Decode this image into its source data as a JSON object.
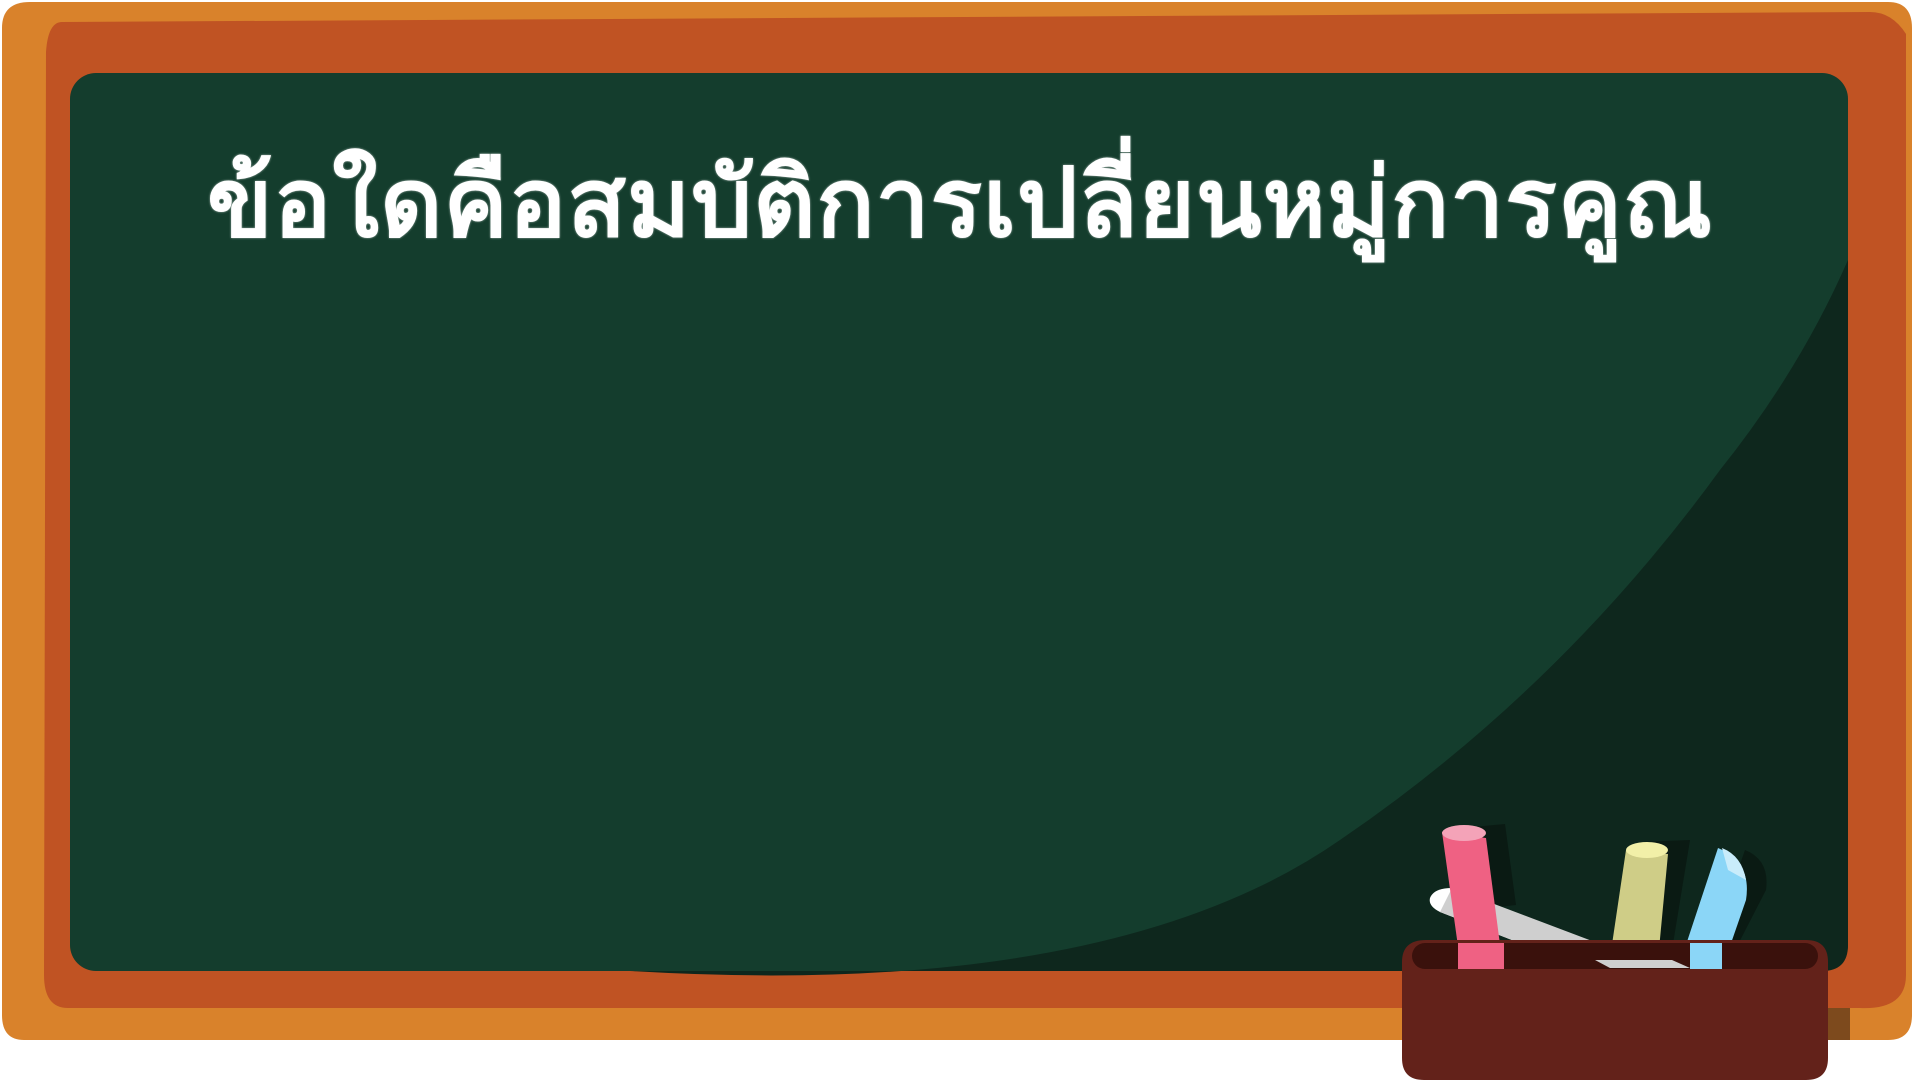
{
  "slide": {
    "title": "ข้อใดคือสมบัติการเปลี่ยนหมู่การคูณ"
  },
  "colors": {
    "outer_frame": "#d9822b",
    "inner_frame": "#c05323",
    "board": "#143d2d",
    "board_shadow": "#0e271d",
    "text": "#ffffff",
    "chalk_box": "#63221a",
    "chalk_box_rim": "#3a110c",
    "chalk_pink": "#ef6183",
    "chalk_yellow": "#cfcd87",
    "chalk_blue": "#8bd6f7",
    "eraser": "#d0d0d0"
  },
  "icons": {
    "chalk_box": "chalk-box-icon",
    "chalk": "chalk-stick-icon",
    "eraser": "eraser-icon"
  }
}
